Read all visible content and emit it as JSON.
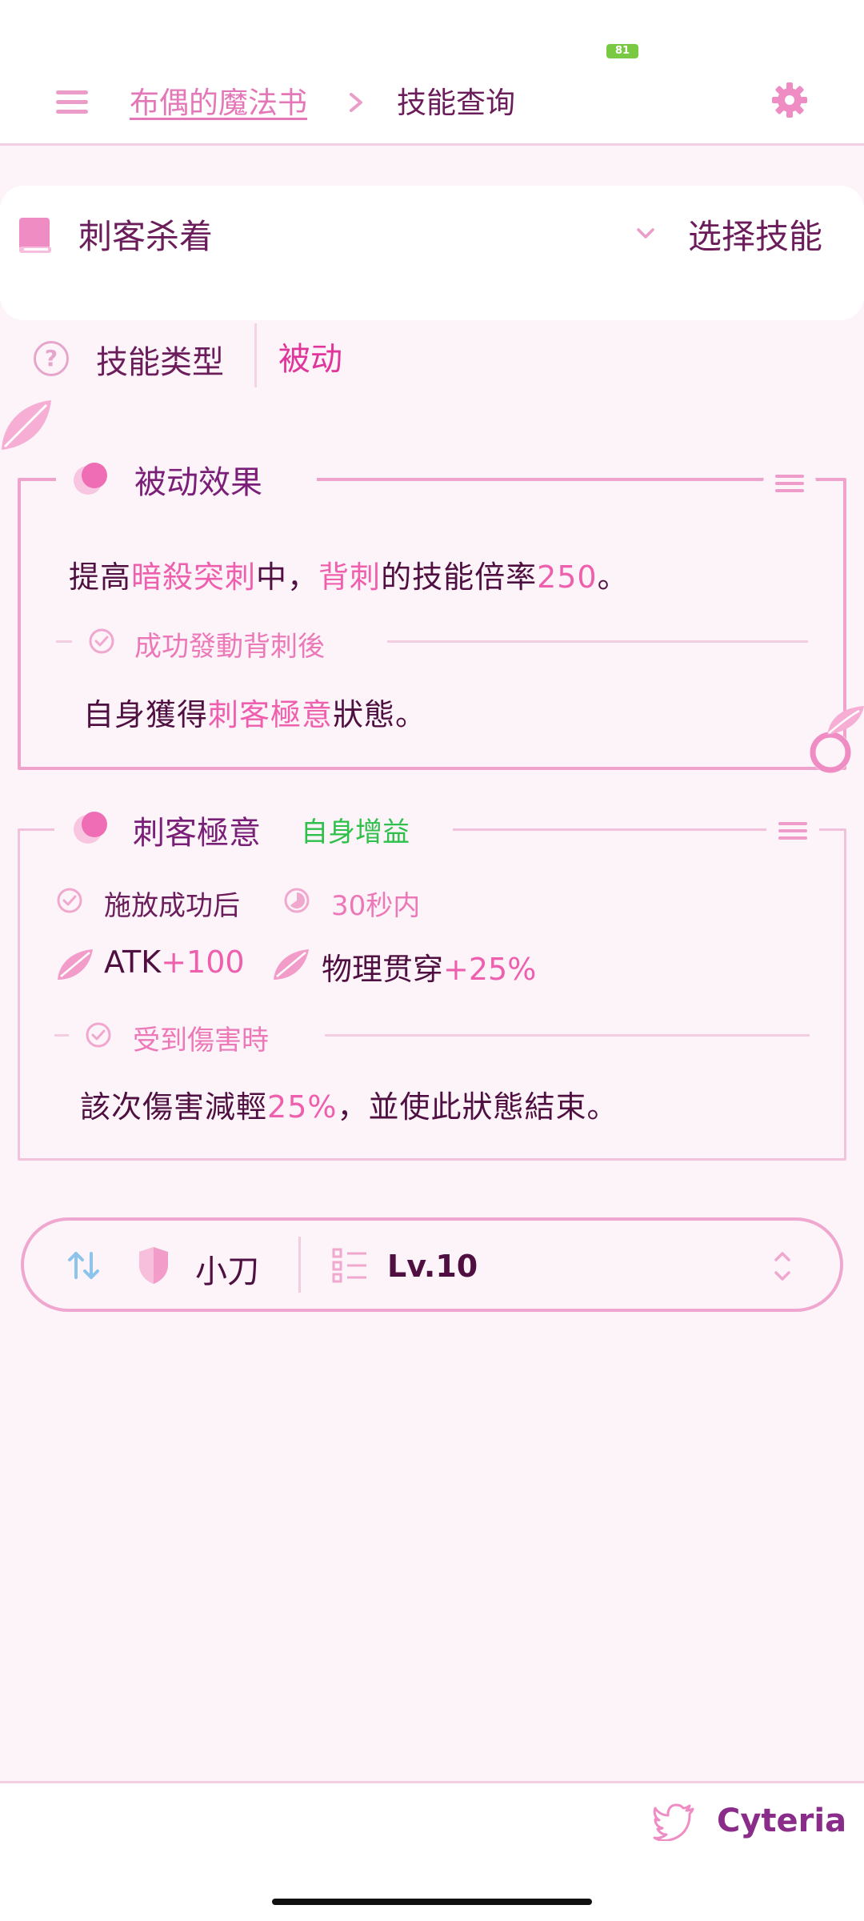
{
  "status_bar": {
    "battery": "81"
  },
  "header": {
    "breadcrumb_parent": "布偶的魔法书",
    "breadcrumb_current": "技能查询"
  },
  "skill_selector": {
    "selected_skill": "刺客杀着",
    "select_label": "选择技能"
  },
  "skill_type": {
    "label": "技能类型",
    "value": "被动"
  },
  "passive_effect": {
    "title": "被动效果",
    "line1": {
      "p1": "提高",
      "p2": "暗殺突刺",
      "p3": "中，",
      "p4": "背刺",
      "p5": "的技能倍率",
      "p6": "250",
      "p7": "。"
    },
    "condition": "成功發動背刺後",
    "line2": {
      "p1": "自身獲得",
      "p2": "刺客極意",
      "p3": "狀態。"
    }
  },
  "state_effect": {
    "title": "刺客極意",
    "tag": "自身增益",
    "trigger": "施放成功后",
    "duration": "30秒内",
    "stats": [
      {
        "name": "ATK",
        "value": "+100"
      },
      {
        "name": "物理贯穿",
        "value": "+25%"
      }
    ],
    "condition": "受到傷害時",
    "line": {
      "p1": "該次傷害減輕",
      "p2": "25%",
      "p3": "，並使此狀態結束。"
    }
  },
  "controls": {
    "weapon": "小刀",
    "level": "Lv.10"
  },
  "footer": {
    "brand": "Cyteria"
  },
  "colors": {
    "accent": "#e0369b",
    "pink_text": "#ee5fae",
    "dark_text": "#4f0f40",
    "buff_green": "#2ec04a",
    "background": "#fdf4fa"
  },
  "icons": [
    "menu-icon",
    "chevron-right-icon",
    "gear-icon",
    "book-icon",
    "chevron-down-icon",
    "question-icon",
    "leaf-icon",
    "moon-icon",
    "hamburger-icon",
    "check-circle-icon",
    "timer-icon",
    "sort-icon",
    "shield-icon",
    "list-icon",
    "updown-icon",
    "twitter-icon",
    "branch-leaf-icon"
  ]
}
